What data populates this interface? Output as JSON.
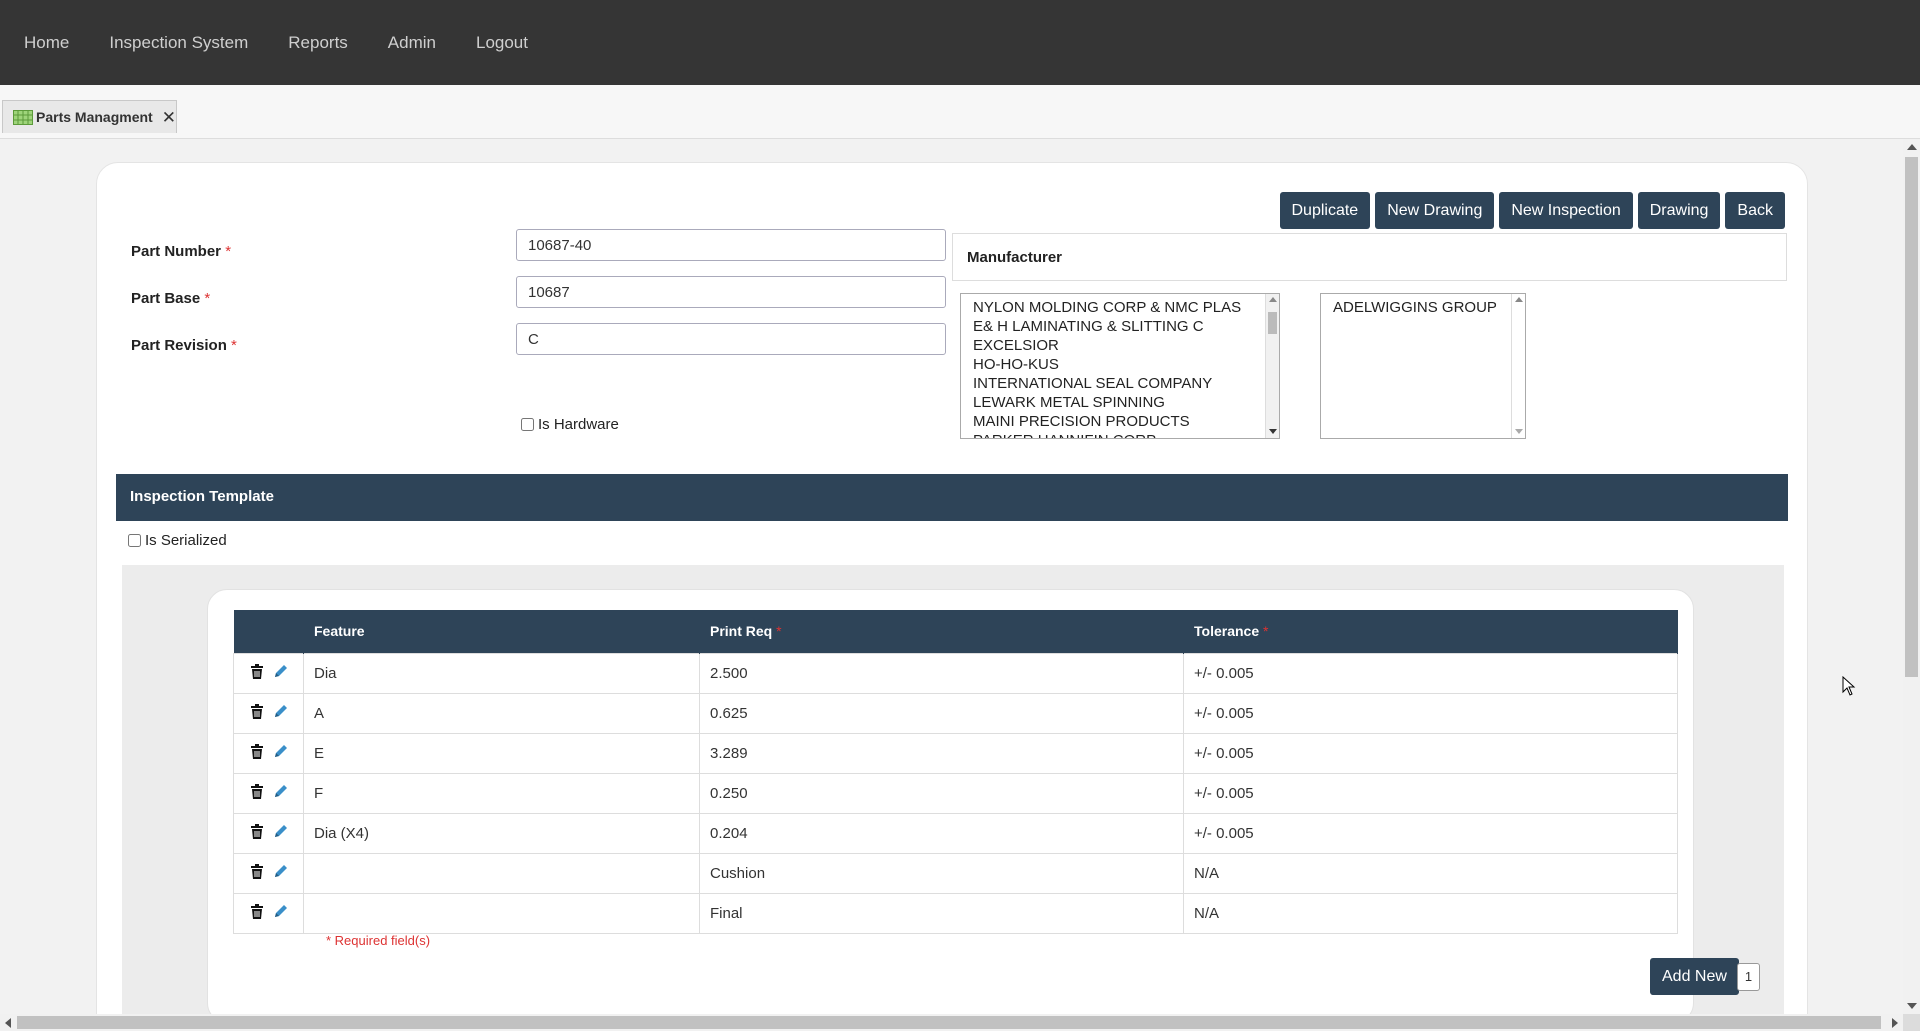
{
  "nav": {
    "items": [
      {
        "label": "Home"
      },
      {
        "label": "Inspection System"
      },
      {
        "label": "Reports"
      },
      {
        "label": "Admin"
      },
      {
        "label": "Logout"
      }
    ]
  },
  "tab": {
    "label": "Parts Managment",
    "icon": "grid-icon",
    "close_icon": "close-icon"
  },
  "actions": {
    "duplicate": "Duplicate",
    "new_drawing": "New Drawing",
    "new_inspection": "New Inspection",
    "drawing": "Drawing",
    "back": "Back"
  },
  "form": {
    "part_number": {
      "label": "Part Number",
      "required_mark": "*",
      "value": "10687-40"
    },
    "part_base": {
      "label": "Part Base",
      "required_mark": "*",
      "value": "10687"
    },
    "part_revision": {
      "label": "Part Revision",
      "required_mark": "*",
      "value": "C"
    },
    "is_hardware": {
      "label": "Is Hardware",
      "checked": false
    }
  },
  "manufacturer": {
    "title": "Manufacturer",
    "available": [
      "NYLON MOLDING CORP & NMC PLAS",
      "E& H LAMINATING & SLITTING C",
      "EXCELSIOR",
      "HO-HO-KUS",
      "INTERNATIONAL SEAL COMPANY",
      "LEWARK METAL SPINNING",
      "MAINI PRECISION PRODUCTS",
      "PARKER HANNIFIN CORP"
    ],
    "selected": [
      "ADELWIGGINS GROUP"
    ],
    "move_buttons": [
      "move-all-right-icon",
      "move-right-icon",
      "move-left-icon",
      "move-all-left-icon"
    ]
  },
  "inspection_template": {
    "title": "Inspection Template",
    "is_serialized": {
      "label": "Is Serialized",
      "checked": false
    },
    "columns": {
      "feature": "Feature",
      "print_req": "Print Req",
      "tolerance": "Tolerance",
      "required_mark": "*"
    },
    "rows": [
      {
        "feature": "Dia",
        "print_req": "2.500",
        "tolerance": "+/- 0.005"
      },
      {
        "feature": "A",
        "print_req": "0.625",
        "tolerance": "+/- 0.005"
      },
      {
        "feature": "E",
        "print_req": "3.289",
        "tolerance": "+/- 0.005"
      },
      {
        "feature": "F",
        "print_req": "0.250",
        "tolerance": "+/- 0.005"
      },
      {
        "feature": "Dia (X4)",
        "print_req": "0.204",
        "tolerance": "+/- 0.005"
      },
      {
        "feature": "",
        "print_req": "Cushion",
        "tolerance": "N/A"
      },
      {
        "feature": "",
        "print_req": "Final",
        "tolerance": "N/A"
      }
    ],
    "required_note": "* Required field(s)",
    "add_new": "Add New",
    "page": "1"
  },
  "colors": {
    "nav_bg": "#353535",
    "header_bg": "#2e4458",
    "accent_blue": "#3a8fc9",
    "required_red": "#d33333"
  }
}
